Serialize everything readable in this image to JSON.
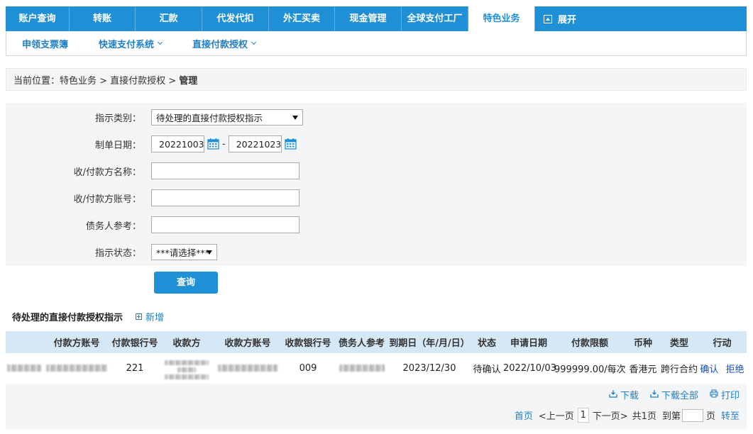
{
  "nav": {
    "tabs": [
      "账户查询",
      "转账",
      "汇款",
      "代发代扣",
      "外汇买卖",
      "现金管理",
      "全球支付工厂",
      "特色业务"
    ],
    "active_tab": "特色业务",
    "expand_label": "展开"
  },
  "subnav": {
    "items": [
      {
        "label": "申领支票簿"
      },
      {
        "label": "快速支付系统"
      },
      {
        "label": "直接付款授权"
      }
    ]
  },
  "breadcrumb": {
    "prefix": "当前位置：特色业务 > 直接付款授权 >",
    "current": "管理"
  },
  "filter": {
    "type_label": "指示类别：",
    "type_value": "待处理的直接付款授权指示",
    "date_label": "制单日期：",
    "date_from": "20221003",
    "date_sep": "-",
    "date_to": "20221023",
    "payee_name_label": "收/付款方名称：",
    "payee_account_label": "收/付款方账号：",
    "debtor_ref_label": "债务人参考：",
    "status_label": "指示状态：",
    "status_value": "***请选择***"
  },
  "query_button": "查询",
  "section": {
    "title": "待处理的直接付款授权指示",
    "add_label": "新增"
  },
  "table": {
    "headers": [
      "付款方账号",
      "付款银行号",
      "收款方",
      "收款方账号",
      "收款银行号",
      "债务人参考",
      "到期日（年/月/日）",
      "状态",
      "申请日期",
      "付款限额",
      "币种",
      "类型",
      "行动"
    ],
    "rows": [
      {
        "payer_bank": "221",
        "payee_bank": "009",
        "due_date": "2023/12/30",
        "status": "待确认",
        "apply_date": "2022/10/03",
        "limit": "999999.00/每次",
        "currency": "香港元",
        "type": "跨行合约",
        "action_confirm": "确认",
        "action_reject": "拒绝"
      }
    ]
  },
  "tools": {
    "download": "下载",
    "download_all": "下载全部",
    "print": "打印"
  },
  "pager": {
    "first": "首页",
    "prev": "<上一页",
    "current": "1",
    "next": "下一页>",
    "total": "共1页",
    "goto": "到第",
    "page_unit": "页",
    "go": "转至"
  },
  "colors": {
    "brand": "#1f8fd6",
    "link": "#1f7fc6",
    "panel": "#f4f5f7",
    "table_header": "#d6e7f5"
  }
}
